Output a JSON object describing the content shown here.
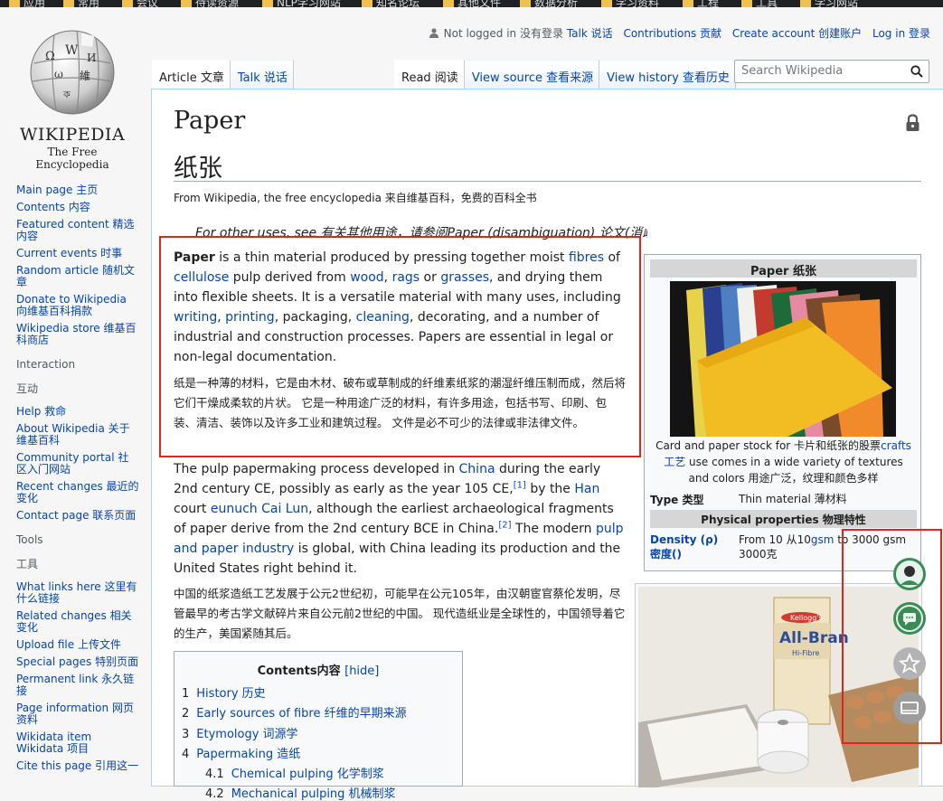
{
  "bookmarks": [
    "应用",
    "常用",
    "会议",
    "待读资源",
    "NLP学习网站",
    "知名论坛",
    "其他文件",
    "数据分析",
    "学习资料",
    "工程",
    "工具",
    "学习网站"
  ],
  "logo": {
    "wordmark": "WIKIPEDIA",
    "tagline": "The Free Encyclopedia"
  },
  "sidebar": {
    "nav": [
      "Main page 主页",
      "Contents 内容",
      "Featured content 精选内容",
      "Current events 时事",
      "Random article 随机文章",
      "Donate to Wikipedia 向维基百科捐款",
      "Wikipedia store 维基百科商店"
    ],
    "interaction_heading": "Interaction",
    "interaction_heading_zh": "互动",
    "interaction": [
      "Help 救命",
      "About Wikipedia 关于维基百科",
      "Community portal 社区入门网站",
      "Recent changes 最近的变化",
      "Contact page 联系页面"
    ],
    "tools_heading": "Tools",
    "tools_heading_zh": "工具",
    "tools": [
      "What links here 这里有什么链接",
      "Related changes 相关变化",
      "Upload file 上传文件",
      "Special pages 特别页面",
      "Permanent link 永久链接",
      "Page information 网页资料",
      "Wikidata item Wikidata 项目",
      "Cite this page 引用这一"
    ]
  },
  "personal": {
    "not_logged_in": "Not logged in 没有登录",
    "talk": "Talk 说话",
    "contributions": "Contributions 贡献",
    "create_account": "Create account 创建账户",
    "login": "Log in 登录"
  },
  "tabs": {
    "article": "Article 文章",
    "talk": "Talk 说话",
    "read": "Read 阅读",
    "view_source": "View source 查看来源",
    "view_history": "View history 查看历史"
  },
  "search": {
    "placeholder": "Search Wikipedia"
  },
  "article": {
    "title_en": "Paper",
    "title_zh": "纸张",
    "from": "From Wikipedia, the free encyclopedia 来自维基百科，免费的百科全书",
    "hatnote": "For other uses, see 有关其他用途，请参阅Paper (disambiguation) 论文(消歧).",
    "p1_zh": "纸是一种薄的材料，它是由木材、破布或草制成的纤维素纸浆的潮湿纤维压制而成，然后将它们干燥成柔软的片状。 它是一种用途广泛的材料，有许多用途，包括书写、印刷、包装、清洁、装饰以及许多工业和建筑过程。 文件是必不可少的法律或非法律文件。",
    "p2_zh": "中国的纸浆造纸工艺发展于公元2世纪初，可能早在公元105年，由汉朝宦官蔡伦发明，尽管最早的考古学文献碎片来自公元前2世纪的中国。 现代造纸业是全球性的，中国领导着它的生产，美国紧随其后。"
  },
  "infobox": {
    "title": "Paper 纸张",
    "caption_a": "Card and paper stock for 卡片和纸张的股票",
    "caption_link": "crafts 工艺",
    "caption_b": " use comes in a wide variety of textures and colors 用途广泛，纹理和颜色多样",
    "type_label": "Type 类型",
    "type_value": "Thin material 薄材料",
    "physical_heading": "Physical properties 物理特性",
    "density_label": "Density (ρ) 密度()",
    "density_value_a": "From 10 从10",
    "density_value_link": "gsm",
    "density_value_b": " to 3000 gsm 3000克"
  },
  "photo": {
    "brand": "Kellogg's",
    "product": "All-Bran",
    "variant": "Hi-Fibre"
  },
  "toc": {
    "title": "Contents内容",
    "hide": "[hide]",
    "items": [
      {
        "num": "1",
        "label": "History 历史"
      },
      {
        "num": "2",
        "label": "Early sources of fibre 纤维的早期来源"
      },
      {
        "num": "3",
        "label": "Etymology 词源学"
      },
      {
        "num": "4",
        "label": "Papermaking 造纸"
      },
      {
        "num": "4.1",
        "label": "Chemical pulping 化学制浆"
      },
      {
        "num": "4.2",
        "label": "Mechanical pulping 机械制浆"
      }
    ]
  },
  "colors": {
    "link": "#0645ad",
    "highlight": "#e0251f",
    "accent": "#3a8c57"
  }
}
